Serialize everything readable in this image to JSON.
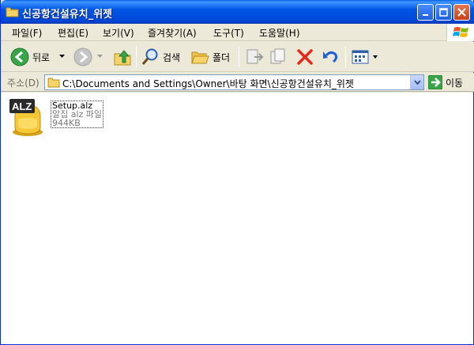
{
  "window": {
    "title": "신공항건설유치_위젯"
  },
  "menu": [
    "파일(F)",
    "편집(E)",
    "보기(V)",
    "즐겨찾기(A)",
    "도구(T)",
    "도움말(H)"
  ],
  "toolbar": {
    "back_label": "뒤로",
    "search_label": "검색",
    "folders_label": "폴더"
  },
  "address": {
    "label": "주소(D)",
    "value": "C:\\Documents and Settings\\Owner\\바탕 화면\\신공항건설유치_위젯",
    "go_label": "이동"
  },
  "files": [
    {
      "name": "Setup.alz",
      "type": "알집 alz 파일",
      "size": "944KB",
      "icon": "alz-file-icon"
    }
  ],
  "colors": {
    "title_bar": "#0054e3",
    "accent": "#0831d9"
  }
}
